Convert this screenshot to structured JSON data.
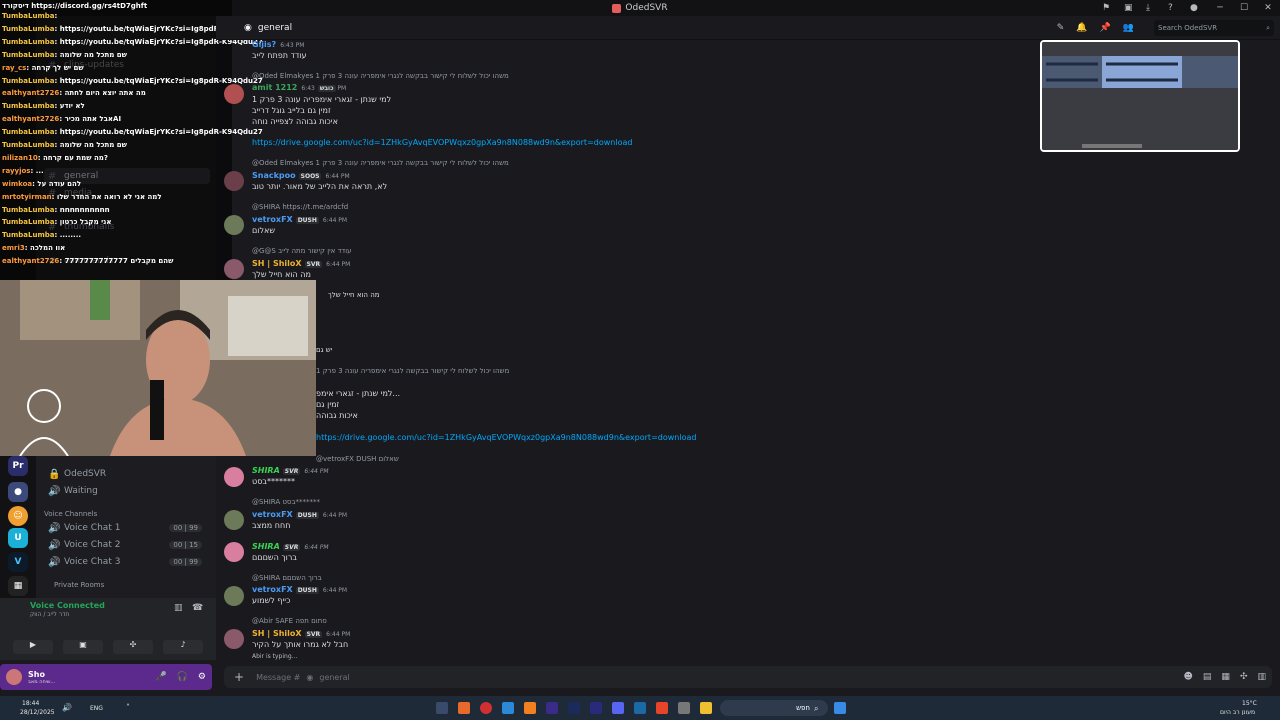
{
  "window": {
    "title": "OdedSVR"
  },
  "header": {
    "channel": "general",
    "search_placeholder": "Search OdedSVR"
  },
  "sidebar": {
    "server_name": "OdedSVR",
    "channels": [
      {
        "label": "clips-updates"
      },
      {
        "label": "general"
      },
      {
        "label": "media"
      },
      {
        "label": "thumbnails"
      },
      {
        "label": "commands"
      },
      {
        "label": "OdedSVR"
      },
      {
        "label": "Waiting"
      }
    ],
    "voice_category": "Voice Channels",
    "voice": [
      {
        "label": "Voice Chat 1",
        "count": "00 | 99"
      },
      {
        "label": "Voice Chat 2",
        "count": "00 | 15"
      },
      {
        "label": "Voice Chat 3",
        "count": "00 | 99"
      }
    ],
    "private_category": "Private Rooms",
    "voice_status": "Voice Connected",
    "voice_sub": "חדר לייב / הווק",
    "user_name": "Sho",
    "user_status": "שיחה מאב..."
  },
  "overlay": {
    "top": "דיסקורד https://discord.gg/rs4tD7ghft",
    "lines": [
      {
        "name": "TumbaLumba",
        "text": ":"
      },
      {
        "name": "TumbaLumba",
        "text": ": https://youtu.be/tqWiaEjrYKc?si=Ig8pdR-K94Qdu27"
      },
      {
        "name": "TumbaLumba",
        "text": ": https://youtu.be/tqWiaEjrYKc?si=Ig8pdR-K94Qdu27"
      },
      {
        "name": "TumbaLumba",
        "text": ": שם מתכל מה שלומה"
      },
      {
        "name": "ray_cs",
        "text": ": שם יש לך קרחה"
      },
      {
        "name": "TumbaLumba",
        "text": ": https://youtu.be/tqWiaEjrYKc?si=Ig8pdR-K94Qdu27"
      },
      {
        "name": "ealthyant2726",
        "text": ": מה אתה יוצא היום לחתה"
      },
      {
        "name": "TumbaLumba",
        "text": ": לא יודע"
      },
      {
        "name": "ealthyant2726",
        "text": ": אבל אתה מכירAI"
      },
      {
        "name": "TumbaLumba",
        "text": ": https://youtu.be/tqWiaEjrYKc?si=Ig8pdR-K94Qdu27"
      },
      {
        "name": "TumbaLumba",
        "text": ": שם מתכל מה שלומה"
      },
      {
        "name": "nilizan10",
        "text": ": מה שמת עם קרחה?"
      },
      {
        "name": "rayyjos",
        "text": ": ..."
      },
      {
        "name": "wimkoa",
        "text": ": להם עודה על"
      },
      {
        "name": "mrtotyirman",
        "text": ": למה אני לא רואה את החדר שלו"
      },
      {
        "name": "TumbaLumba",
        "text": ": nnnnnnnnnn"
      },
      {
        "name": "TumbaLumba",
        "text": ": אני מקבל כרטון"
      },
      {
        "name": "TumbaLumba",
        "text": ": ........"
      },
      {
        "name": "emri3",
        "text": ": אוו המלכה"
      },
      {
        "name": "ealthyant2726",
        "text": ": שהם מקבלים 7777777777777"
      }
    ]
  },
  "messages": [
    {
      "author": "Gijis?",
      "time": "6:43 PM",
      "text": "עודד תפתח לייב"
    },
    {
      "reply": "@Oded Elmakyes משהו יכול לשלוח לי קישור בבקשה לנגרי אימפריה עונה 3 פרק 1",
      "author": "amit 1212",
      "tag": "כובש",
      "time": "6:43 PM",
      "text": "למי שנתן - זגארי אימפריה עונה 3 פרק 1",
      "text2": "זמין גם בלייב גוגל דרייב",
      "text3": "איכות גבוהה לצפייה נוחה",
      "link": "https://drive.google.com/uc?id=1ZHkGyAvqEVOPWqxz0gpXa9n8N088wd9n&export=download"
    },
    {
      "reply": "@Oded Elmakyes משהו יכול לשלוח לי קישור בבקשה לנגרי אימפריה עונה 3 פרק 1",
      "author": "Snackpoo",
      "tag": "SOOS",
      "time": "6:44 PM",
      "text": "לא, תראה את הלייב של מאור. יותר טוב"
    },
    {
      "reply": "@SHIRA https://t.me/ardcfd",
      "author": "vetroxFX",
      "tag": "DUSH",
      "time": "6:44 PM",
      "text": "שאלום"
    },
    {
      "reply": "@G@S עודד אין קישור מתה לייב",
      "author": "SH | ShiloX",
      "tag": "SVR",
      "time": "6:44 PM",
      "text": "מה הוא חייל שלך"
    },
    {
      "text_mid": "מה הוא חייל שלך"
    },
    {
      "text_mid2": "יש גם"
    },
    {
      "reply": "משהו יכול לשלוח לי קישור בבקשה לנגרי אימפריה עונה 3 פרק 1",
      "text": "למי שנתן - זגארי אימפ...",
      "text2": "זמין גם",
      "text3": "איכות גבוהה",
      "link": "https://drive.google.com/uc?id=1ZHkGyAvqEVOPWqxz0gpXa9n8N088wd9n&export=download"
    },
    {
      "reply": "@vetroxFX DUSH שאלום",
      "author": "SHIRA",
      "tag": "SVR",
      "time": "6:44 PM",
      "text": "בסט*******"
    },
    {
      "reply": "@SHIRA בסט*******",
      "author": "vetroxFX",
      "tag": "DUSH",
      "time": "6:44 PM",
      "text": "חחח ממצב"
    },
    {
      "author": "SHIRA",
      "tag": "SVR",
      "time": "6:44 PM",
      "text": "ברוך השםםם"
    },
    {
      "reply": "@SHIRA ברוך השםםם",
      "author": "vetroxFX",
      "tag": "DUSH",
      "time": "6:44 PM",
      "text": "כייף לשמוע"
    },
    {
      "reply": "@Abir SAFE סתום תפה",
      "author": "SH | ShiloX",
      "tag": "SVR",
      "time": "6:44 PM",
      "text": "חבל לא גמרו אותך על הקיר"
    }
  ],
  "typing": "Abir is typing...",
  "composer": {
    "placeholder": "Message #",
    "channel": "general"
  },
  "taskbar": {
    "time": "18:44",
    "date": "28/12/2025",
    "lang": "ENG",
    "search": "חפש",
    "weather": "15°C",
    "weather_sub": "מעונן רב היום"
  },
  "colors": {
    "accent": "#5865f2",
    "link": "#00a8fc",
    "user_panel": "#5b2a8c"
  }
}
